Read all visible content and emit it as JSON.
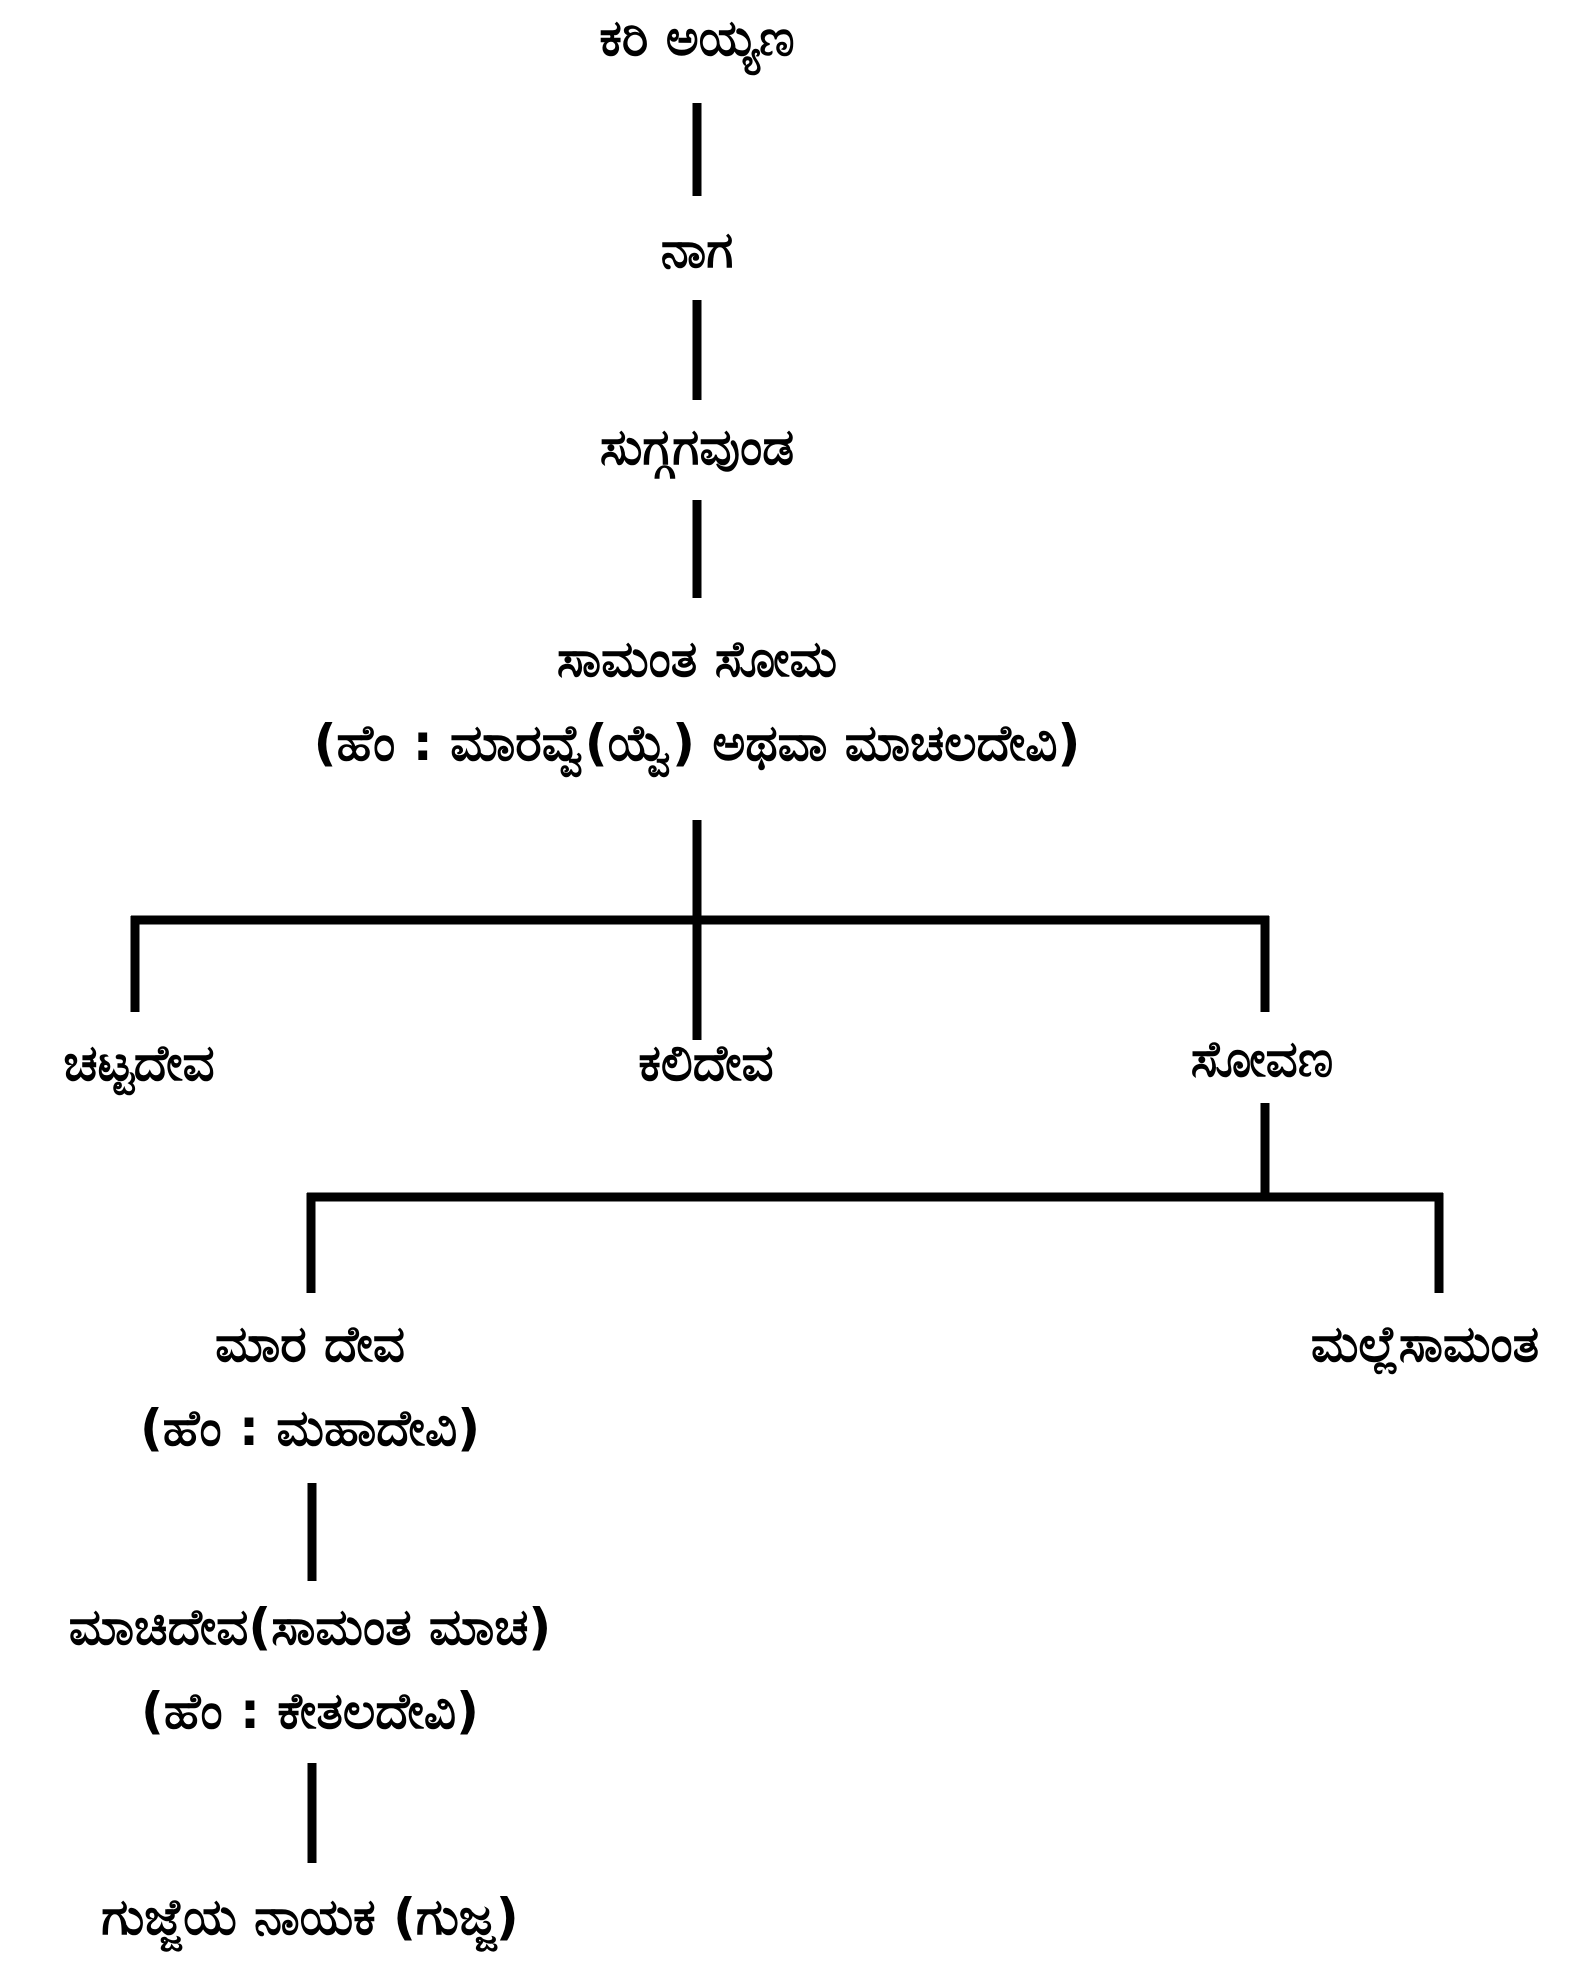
{
  "colors": {
    "background": "#ffffff",
    "ink": "#000000"
  },
  "family_tree": {
    "kari_ayyana": "ಕರಿ ಅಯ್ಯಣ",
    "naga": "ನಾಗ",
    "suggagavunda": "ಸುಗ್ಗಗವುಂಡ",
    "samanta_soma": {
      "name": "ಸಾಮಂತ ಸೋಮ",
      "spouse": "(ಹೆಂ : ಮಾರವ್ವೆ(ಯ್ವೆ) ಅಥವಾ ಮಾಚಲದೇವಿ)"
    },
    "chattadeva": "ಚಟ್ಟದೇವ",
    "kalideva": "ಕಲಿದೇವ",
    "sovana": "ಸೋವಣ",
    "mara_deva": {
      "name": "ಮಾರ ದೇವ",
      "spouse": "(ಹೆಂ : ಮಹಾದೇವಿ)"
    },
    "mallesamanta": "ಮಲ್ಲೆಸಾಮಂತ",
    "machideva": {
      "name": "ಮಾಚಿದೇವ(ಸಾಮಂತ ಮಾಚ)",
      "spouse": "(ಹೆಂ : ಕೇತಲದೇವಿ)"
    },
    "gujjeya_nayaka": "ಗುಜ್ಜೆಯ ನಾಯಕ (ಗುಜ್ಜ)"
  }
}
